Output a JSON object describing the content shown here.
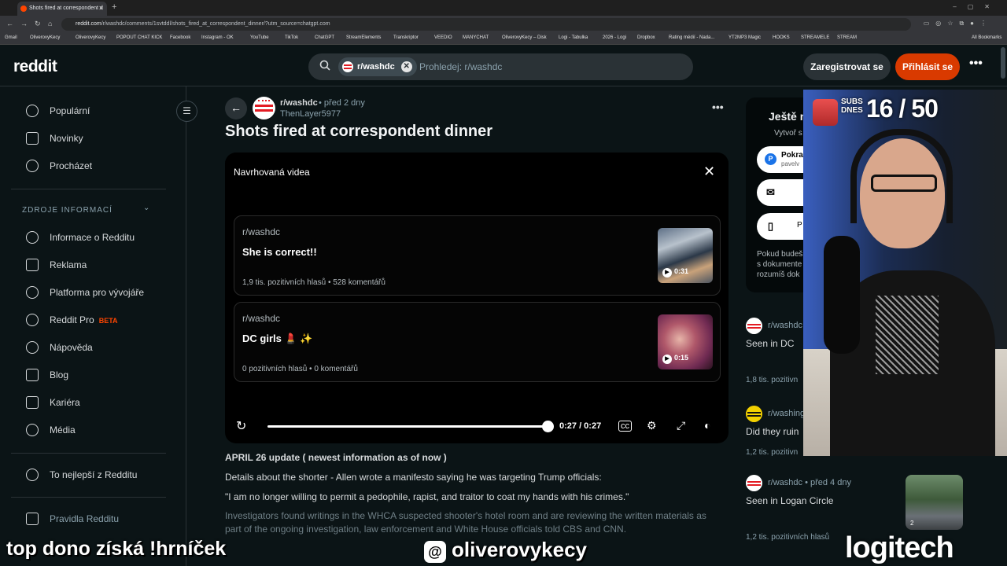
{
  "browser": {
    "tab_title": "Shots fired at correspondent d",
    "url_domain": "reddit.com",
    "url_path": "/r/washdc/comments/1svtddl/shots_fired_at_correspondent_dinner/?utm_source=chatgpt.com",
    "bookmarks": [
      "Gmail",
      "OliverovyKecy",
      "OliverovyKecy",
      "POPOUT CHAT KICK",
      "Facebook",
      "Instagram - OK",
      "YouTube",
      "TikTok",
      "ChatGPT",
      "StreamElements",
      "Transkriptor",
      "VEEDIO",
      "MANYCHAT",
      "OliverovyKecy – Disk",
      "Logi - Tabulka",
      "2026 - Logi",
      "Dropbox",
      "Rating médií - Nada...",
      "YT2MP3 Magic",
      "HOOKS",
      "STREAMELE",
      "STREAM"
    ],
    "all_bookmarks": "All Bookmarks"
  },
  "header": {
    "logo": "reddit",
    "search_chip": "r/washdc",
    "search_placeholder": "Prohledej: r/washdc",
    "register_label": "Zaregistrovat se",
    "login_label": "Přihlásit se",
    "more_label": "•••"
  },
  "sidebar": {
    "items": [
      {
        "label": "Populární"
      },
      {
        "label": "Novinky"
      },
      {
        "label": "Procházet"
      }
    ],
    "section_title": "ZDROJE INFORMACÍ",
    "resources": [
      {
        "label": "Informace o Redditu"
      },
      {
        "label": "Reklama"
      },
      {
        "label": "Platforma pro vývojáře"
      },
      {
        "label": "Reddit Pro",
        "badge": "BETA"
      },
      {
        "label": "Nápověda"
      },
      {
        "label": "Blog"
      },
      {
        "label": "Kariéra"
      },
      {
        "label": "Média"
      }
    ],
    "best": "To nejlepší z Redditu",
    "rules": "Pravidla Redditu"
  },
  "post": {
    "subreddit": "r/washdc",
    "time": "• před 2 dny",
    "author": "ThenLayer5977",
    "more": "•••",
    "title": "Shots fired at correspondent dinner",
    "body": [
      "APRIL 26 update ( newest information as of now )",
      "Details about the shorter - Allen wrote a manifesto saying he was targeting Trump officials:",
      "\"I am no longer willing to permit a pedophile, rapist, and traitor to coat my hands with his crimes.\"",
      "Investigators found writings in the WHCA suspected shooter's hotel room and are reviewing the written materials as",
      "part of the ongoing investigation, law enforcement and White House officials told CBS and CNN."
    ]
  },
  "video": {
    "panel_title": "Navrhovaná videa",
    "cards": [
      {
        "subreddit": "r/washdc",
        "title": "She is correct!!",
        "stats": "1,9 tis. pozitivních hlasů • 528 komentářů",
        "duration": "0:31"
      },
      {
        "subreddit": "r/washdc",
        "title": "DC girls 💄 ✨",
        "stats": "0 pozitivních hlasů • 0 komentářů",
        "duration": "0:15"
      }
    ],
    "time_display": "0:27 / 0:27",
    "progress": 1.0
  },
  "right": {
    "card_title": "Ještě n",
    "card_sub": "Vytvoř s",
    "pill1_title": "Pokra",
    "pill1_sub": "pavelv",
    "pill3": "P",
    "card_text": "Pokud budeš\ns dokumente\nrozumíš dok",
    "posts": [
      {
        "subreddit": "r/washdc",
        "title": "Seen in DC",
        "stats": "1,8 tis. pozitivn"
      },
      {
        "subreddit": "r/washing",
        "title": "Did they ruin",
        "stats": "1,2 tis. pozitivn"
      },
      {
        "subreddit": "r/washdc • před 4 dny",
        "title": "Seen in Logan Circle",
        "stats": "1,2 tis. pozitivních hlasů",
        "thumb_badge": "2"
      }
    ]
  },
  "stream": {
    "subs_label": "SUBS DNES",
    "subs_count": "16 / 50",
    "left_text": "top dono získá !hrníček",
    "threads_handle": "oliverovykecy",
    "threads_icon": "@",
    "sponsor": "logitech"
  },
  "colors": {
    "bg": "#0b1416",
    "accent": "#d93a00",
    "beta": "#ff4500"
  }
}
